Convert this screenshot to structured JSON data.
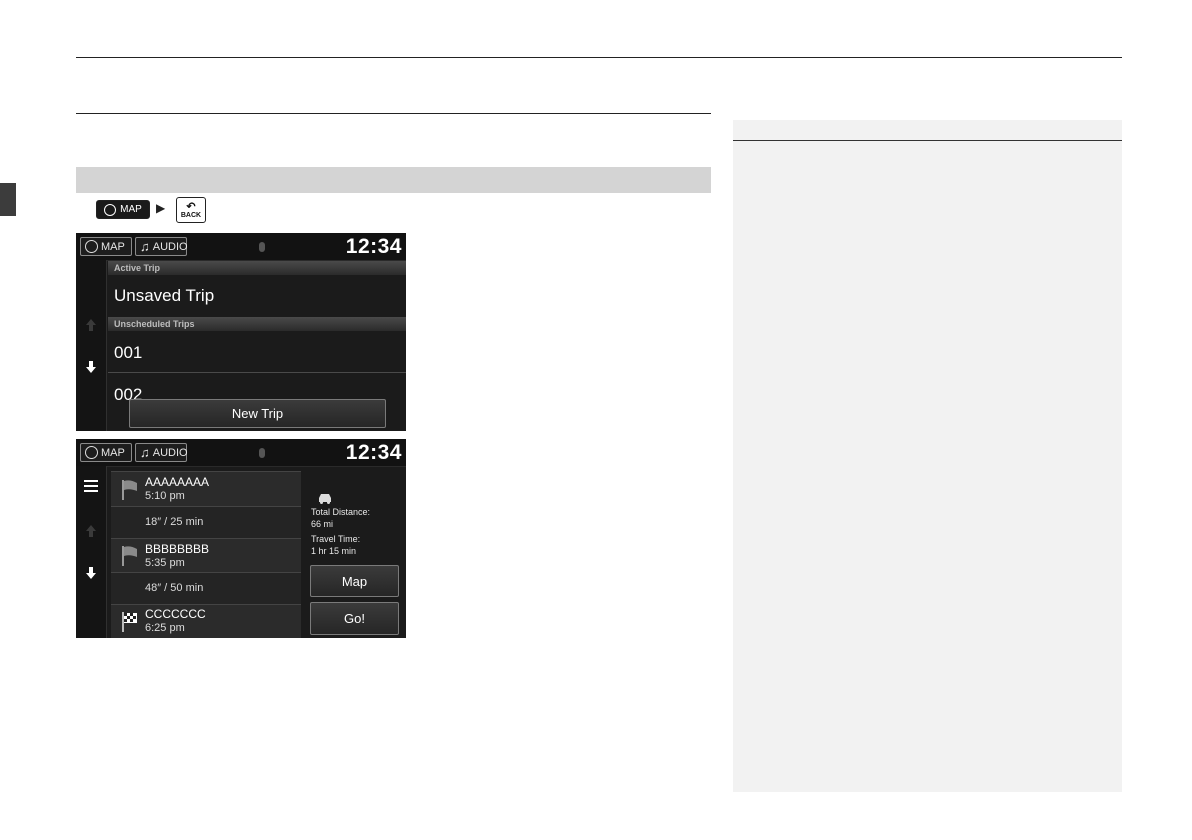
{
  "keys": {
    "map_label": "MAP",
    "back_label": "BACK"
  },
  "screen1": {
    "map_btn": "MAP",
    "audio_btn": "AUDIO",
    "clock": "12:34",
    "active_header": "Active Trip",
    "active_item": "Unsaved Trip",
    "unscheduled_header": "Unscheduled Trips",
    "items": [
      "001",
      "002"
    ],
    "new_trip": "New Trip"
  },
  "screen2": {
    "map_btn": "MAP",
    "audio_btn": "AUDIO",
    "clock": "12:34",
    "stops": [
      {
        "name": "AAAAAAAA",
        "time": "5:10 pm",
        "flag": "flag-icon"
      },
      {
        "leg": "18″ / 25 min"
      },
      {
        "name": "BBBBBBBB",
        "time": "5:35 pm",
        "flag": "flag-icon"
      },
      {
        "leg": "48″ / 50 min"
      },
      {
        "name": "CCCCCCC",
        "time": "6:25 pm",
        "flag": "checkered-flag-icon"
      }
    ],
    "total_distance_label": "Total Distance:",
    "total_distance_value": "66 mi",
    "travel_time_label": "Travel Time:",
    "travel_time_value": "1 hr 15 min",
    "map_button": "Map",
    "go_button": "Go!"
  }
}
